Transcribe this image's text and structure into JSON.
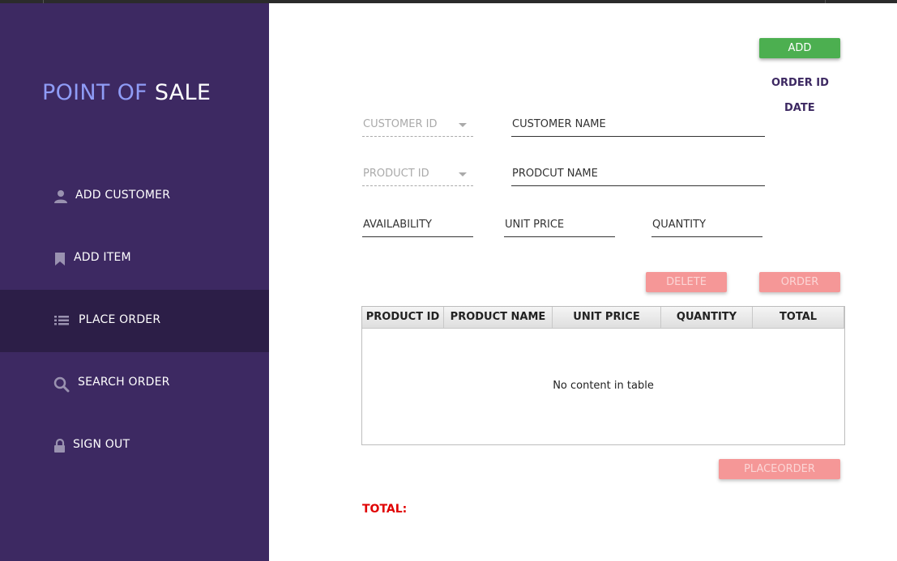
{
  "app": {
    "title_part1": "POINT OF ",
    "title_part2": "SALE"
  },
  "sidebar": {
    "items": [
      {
        "label": "ADD CUSTOMER",
        "icon": "user-icon"
      },
      {
        "label": "ADD ITEM",
        "icon": "bookmark-icon"
      },
      {
        "label": "PLACE ORDER",
        "icon": "list-icon",
        "active": true
      },
      {
        "label": "SEARCH ORDER",
        "icon": "search-icon"
      },
      {
        "label": "SIGN OUT",
        "icon": "lock-icon"
      }
    ]
  },
  "order": {
    "add_label": "ADD",
    "order_id_label": "ORDER ID",
    "date_label": "DATE"
  },
  "form": {
    "customer_id": "CUSTOMER ID",
    "customer_name": "CUSTOMER NAME",
    "product_id": "PRODUCT ID",
    "product_name": "PRODCUT NAME",
    "availability": "AVAILABILITY",
    "unit_price": "UNIT PRICE",
    "quantity": "QUANTITY"
  },
  "actions": {
    "delete_label": "DELETE",
    "order_label": "ORDER",
    "placeorder_label": "PLACEORDER"
  },
  "table": {
    "columns": [
      "PRODUCT ID",
      "PRODUCT NAME",
      "UNIT PRICE",
      "QUANTITY",
      "TOTAL"
    ],
    "empty_text": "No content in table"
  },
  "footer": {
    "total_label": "TOTAL:"
  },
  "colors": {
    "sidebar": "#3d2962",
    "sidebar_active": "#2c1e47",
    "title_accent": "#8f9cf6",
    "add_button": "#4caf50",
    "disabled_button": "#f59797",
    "total_text": "#e00000"
  }
}
